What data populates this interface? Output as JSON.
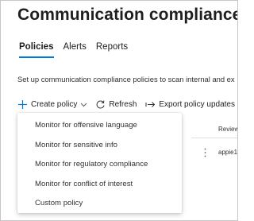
{
  "page": {
    "title": "Communication compliance"
  },
  "tabs": [
    {
      "label": "Policies",
      "active": true
    },
    {
      "label": "Alerts",
      "active": false
    },
    {
      "label": "Reports",
      "active": false
    }
  ],
  "description": "Set up communication compliance policies to scan internal and ex",
  "toolbar": {
    "create_policy_label": "Create policy",
    "refresh_label": "Refresh",
    "export_label": "Export policy updates"
  },
  "table": {
    "columns": [
      "Review"
    ],
    "rows": [
      {
        "reviewer": "appie1"
      }
    ]
  },
  "create_policy_menu": {
    "items": [
      "Monitor for offensive language",
      "Monitor for sensitive info",
      "Monitor for regulatory compliance",
      "Monitor for conflict of interest",
      "Custom policy"
    ]
  },
  "icons": {
    "create": "plus-icon",
    "expand": "chevron-down-icon",
    "refresh": "refresh-icon",
    "export": "export-icon",
    "row_actions": "more-vertical-icon"
  },
  "colors": {
    "accent": "#0078d4",
    "text": "#201f1e",
    "divider": "#e1dfdd"
  }
}
